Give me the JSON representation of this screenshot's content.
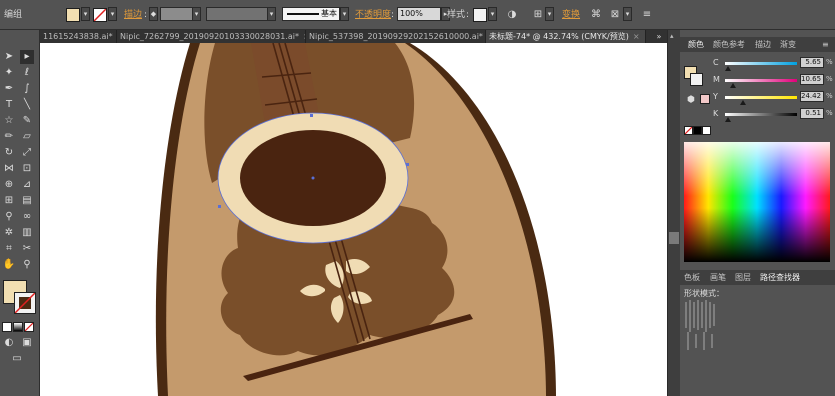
{
  "control_bar": {
    "selection_label": "编组",
    "stroke_label": "描边",
    "stroke_profile_label": "基本",
    "opacity_label": "不透明度",
    "opacity_value": "100%",
    "style_label": "样式",
    "transform_label": "变换"
  },
  "document_tabs": [
    {
      "label": "11615243838.ai*",
      "close": "×"
    },
    {
      "label": "Nipic_7262799_20190920103330028031.ai*",
      "close": "×"
    },
    {
      "label": "Nipic_537398_20190929202152610000.ai*",
      "close": "×"
    },
    {
      "label": "未标题-74* @ 432.74% (CMYK/预览)",
      "close": "×"
    }
  ],
  "color_panel": {
    "tabs": [
      "颜色",
      "颜色参考",
      "描边",
      "渐变"
    ],
    "channels": [
      {
        "name": "C",
        "value": "5.65",
        "unit": "%",
        "level": 0.0565
      },
      {
        "name": "M",
        "value": "10.65",
        "unit": "%",
        "level": 0.1065
      },
      {
        "name": "Y",
        "value": "24.42",
        "unit": "%",
        "level": 0.2442
      },
      {
        "name": "K",
        "value": "0.51",
        "unit": "%",
        "level": 0.0051
      }
    ],
    "fill_color": "#f2dfb2"
  },
  "lower_panel": {
    "tabs": [
      "色板",
      "画笔",
      "图层",
      "路径查找器"
    ],
    "content_label": "形状模式："
  },
  "colors": {
    "ui_dark": "#535353",
    "canvas": "#ffffff",
    "body_dark": "#4a2a12",
    "body_light": "#c49a6c",
    "body_mid": "#7a4f2a",
    "neck": "#7b4b2b",
    "ring": "#f0dcb4",
    "soundhole": "#4a2410",
    "accent_orange": "#e09a3a"
  }
}
